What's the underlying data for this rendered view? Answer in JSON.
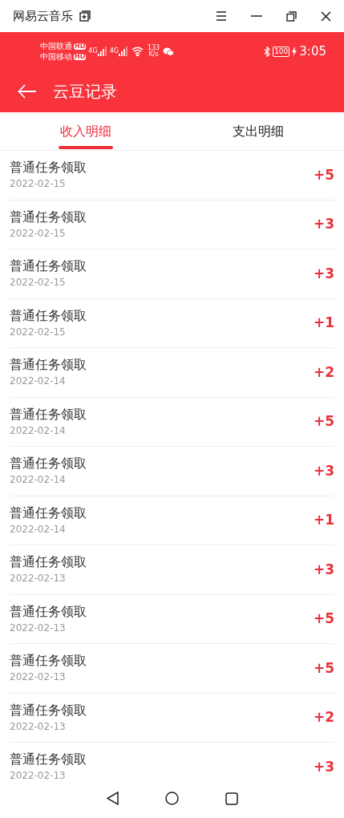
{
  "window": {
    "title": "网易云音乐"
  },
  "status_bar": {
    "carriers": [
      {
        "name": "中国联通",
        "badge": "HD"
      },
      {
        "name": "中国移动",
        "badge": "HD"
      }
    ],
    "networks": [
      "4G",
      "4G"
    ],
    "speed": [
      "133",
      "K/s"
    ],
    "battery": "100",
    "time": "3:05"
  },
  "app_bar": {
    "title": "云豆记录"
  },
  "tabs": [
    {
      "label": "收入明细",
      "selected": true
    },
    {
      "label": "支出明细",
      "selected": false
    }
  ],
  "records": [
    {
      "title": "普通任务领取",
      "date": "2022-02-15",
      "amount": "+5"
    },
    {
      "title": "普通任务领取",
      "date": "2022-02-15",
      "amount": "+3"
    },
    {
      "title": "普通任务领取",
      "date": "2022-02-15",
      "amount": "+3"
    },
    {
      "title": "普通任务领取",
      "date": "2022-02-15",
      "amount": "+1"
    },
    {
      "title": "普通任务领取",
      "date": "2022-02-14",
      "amount": "+2"
    },
    {
      "title": "普通任务领取",
      "date": "2022-02-14",
      "amount": "+5"
    },
    {
      "title": "普通任务领取",
      "date": "2022-02-14",
      "amount": "+3"
    },
    {
      "title": "普通任务领取",
      "date": "2022-02-14",
      "amount": "+1"
    },
    {
      "title": "普通任务领取",
      "date": "2022-02-13",
      "amount": "+3"
    },
    {
      "title": "普通任务领取",
      "date": "2022-02-13",
      "amount": "+5"
    },
    {
      "title": "普通任务领取",
      "date": "2022-02-13",
      "amount": "+5"
    },
    {
      "title": "普通任务领取",
      "date": "2022-02-13",
      "amount": "+2"
    },
    {
      "title": "普通任务领取",
      "date": "2022-02-13",
      "amount": "+3"
    }
  ]
}
